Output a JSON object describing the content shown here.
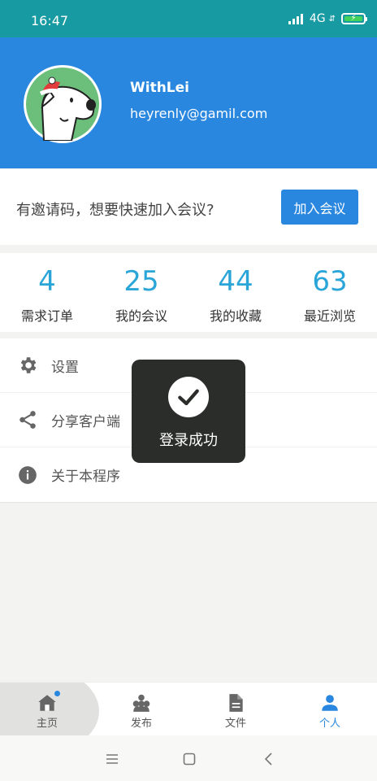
{
  "status_bar": {
    "time": "16:47",
    "network": "4G",
    "icons": [
      "signal-icon",
      "battery-icon"
    ]
  },
  "profile": {
    "name": "WithLei",
    "email": "heyrenly@gamil.com",
    "avatar": "dog-avatar"
  },
  "invite": {
    "text": "有邀请码，想要快速加入会议?",
    "button_label": "加入会议"
  },
  "stats": [
    {
      "value": "4",
      "label": "需求订单"
    },
    {
      "value": "25",
      "label": "我的会议"
    },
    {
      "value": "44",
      "label": "我的收藏"
    },
    {
      "value": "63",
      "label": "最近浏览"
    }
  ],
  "menu": [
    {
      "label": "设置",
      "icon": "gear-icon"
    },
    {
      "label": "分享客户端",
      "icon": "share-icon"
    },
    {
      "label": "关于本程序",
      "icon": "info-icon"
    }
  ],
  "toast": {
    "text": "登录成功",
    "icon": "check-icon"
  },
  "tabs": [
    {
      "label": "主页",
      "icon": "home-icon",
      "active": false,
      "has_badge": true
    },
    {
      "label": "发布",
      "icon": "publish-icon",
      "active": false
    },
    {
      "label": "文件",
      "icon": "file-icon",
      "active": false
    },
    {
      "label": "个人",
      "icon": "person-icon",
      "active": true
    }
  ],
  "colors": {
    "status_bar": "#179aa2",
    "primary": "#2a87df",
    "stat_number": "#2aa5d8",
    "toast_bg": "#2b2d2a"
  }
}
